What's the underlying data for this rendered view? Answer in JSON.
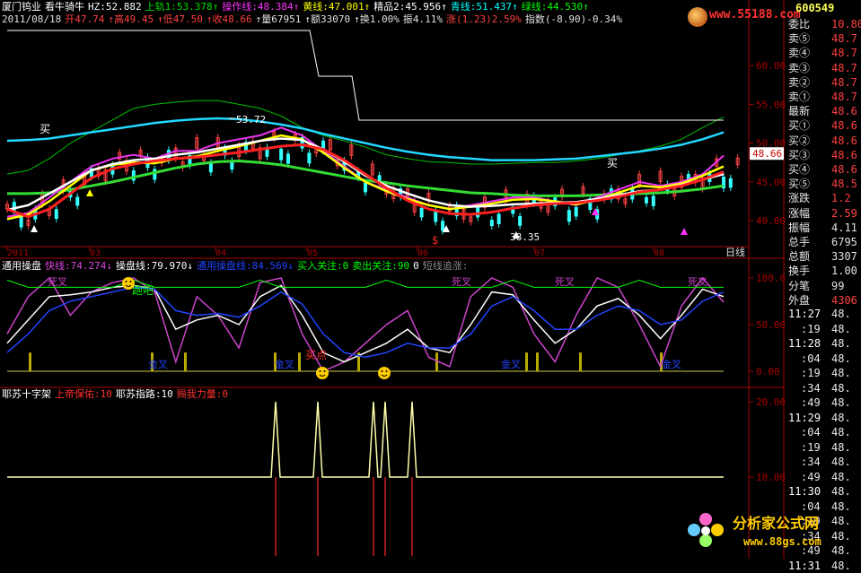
{
  "stock": {
    "name": "厦门钨业",
    "date": "2011/08/18"
  },
  "header": {
    "line1": [
      {
        "text": "厦门钨业",
        "color": "#ffffff"
      },
      {
        "text": "看牛骑牛",
        "color": "#ffffff"
      },
      {
        "text": "HZ:52.882",
        "color": "#ffffff"
      },
      {
        "text": "上轨1:53.378↑",
        "color": "#00e000"
      },
      {
        "text": "操作线:48.384↑",
        "color": "#ff33ff"
      },
      {
        "text": "黄线:47.001↑",
        "color": "#ffff00"
      },
      {
        "text": "精品2:45.956↑",
        "color": "#ffffff"
      },
      {
        "text": "青线:51.437↑",
        "color": "#00ffff"
      },
      {
        "text": "绿线:44.530↑",
        "color": "#00ff00"
      }
    ],
    "line2": [
      {
        "text": "2011/08/18",
        "color": "#e0e0e0"
      },
      {
        "text": "开47.74",
        "color": "#ff4040"
      },
      {
        "text": "↑高49.45",
        "color": "#ff4040"
      },
      {
        "text": "↑低47.50",
        "color": "#ff4040"
      },
      {
        "text": "↑收48.66",
        "color": "#ff4040"
      },
      {
        "text": "↑量67951",
        "color": "#e0e0e0"
      },
      {
        "text": "↑额33070",
        "color": "#e0e0e0"
      },
      {
        "text": "↑换1.00%",
        "color": "#e0e0e0"
      },
      {
        "text": "振4.11%",
        "color": "#e0e0e0"
      },
      {
        "text": "涨(1.23)2.59%",
        "color": "#ff4040"
      },
      {
        "text": "指数(-8.90)-0.34%",
        "color": "#e0e0e0"
      }
    ]
  },
  "main_chart": {
    "y_ticks": [
      "60.00",
      "55.00",
      "50.00",
      "45.00",
      "40.00"
    ],
    "x_labels": [
      "2011",
      "03",
      "04",
      "05",
      "06",
      "07",
      "08"
    ],
    "x_axis_unit": "日线",
    "annotations": {
      "high": "53.72",
      "low": "38.35",
      "buy1": "买",
      "buy2": "买",
      "sell": "$"
    },
    "current_price": "48.66",
    "watermark": "www.55188.com"
  },
  "indicator1": {
    "legend": [
      {
        "text": "通用操盘",
        "color": "#ffffff"
      },
      {
        "text": "快线:74.274↓",
        "color": "#dd44dd"
      },
      {
        "text": "操盘线:79.970↓",
        "color": "#ffffff"
      },
      {
        "text": "通用操盘线:84.569↓",
        "color": "#2244ff"
      },
      {
        "text": "买入关注:0",
        "color": "#00ff00"
      },
      {
        "text": "卖出关注:90",
        "color": "#00ff00"
      },
      {
        "text": "0",
        "color": "#ffffff"
      },
      {
        "text": "短线追涨:",
        "color": "#888888"
      }
    ],
    "y_ticks": [
      "100.00",
      "50.00",
      "0.00"
    ],
    "labels": {
      "dead_cross_1": "死叉",
      "dead_cross_2": "死叉",
      "dead_cross_3": "死叉",
      "dead_cross_4": "死叉",
      "run": "跑吧",
      "buy_point": "买点",
      "gold_1": "金叉",
      "gold_2": "金叉",
      "gold_3": "金叉",
      "gold_4": "金叉"
    }
  },
  "indicator2": {
    "legend": [
      {
        "text": "耶苏十字架",
        "color": "#ffffff"
      },
      {
        "text": "上帝保佑:10",
        "color": "#ff3030"
      },
      {
        "text": "耶苏指路:10",
        "color": "#ffffff"
      },
      {
        "text": "赐我力量:0",
        "color": "#ff3030"
      }
    ],
    "y_ticks": [
      "20.00",
      "10.00"
    ]
  },
  "quote_panel": {
    "code": "600549",
    "rows": [
      {
        "label": "委比",
        "value": "10.80",
        "color": "#ff4040"
      },
      {
        "label": "卖⑤",
        "value": "48.7",
        "color": "#ff4040"
      },
      {
        "label": "卖④",
        "value": "48.7",
        "color": "#ff4040"
      },
      {
        "label": "卖③",
        "value": "48.7",
        "color": "#ff4040"
      },
      {
        "label": "卖②",
        "value": "48.7",
        "color": "#ff4040"
      },
      {
        "label": "卖①",
        "value": "48.7",
        "color": "#ff4040"
      },
      {
        "label": "最新",
        "value": "48.6",
        "color": "#ff4040"
      },
      {
        "label": "买①",
        "value": "48.6",
        "color": "#ff4040"
      },
      {
        "label": "买②",
        "value": "48.6",
        "color": "#ff4040"
      },
      {
        "label": "买③",
        "value": "48.6",
        "color": "#ff4040"
      },
      {
        "label": "买④",
        "value": "48.6",
        "color": "#ff4040"
      },
      {
        "label": "买⑤",
        "value": "48.5",
        "color": "#ff4040"
      },
      {
        "label": "涨跌",
        "value": "1.2",
        "color": "#ff4040"
      },
      {
        "label": "涨幅",
        "value": "2.59",
        "color": "#ff4040"
      },
      {
        "label": "振幅",
        "value": "4.11",
        "color": "#e0e0e0"
      },
      {
        "label": "总手",
        "value": "6795",
        "color": "#e0e0e0"
      },
      {
        "label": "总额",
        "value": "3307",
        "color": "#e0e0e0"
      },
      {
        "label": "换手",
        "value": "1.00",
        "color": "#e0e0e0"
      },
      {
        "label": "分笔",
        "value": "99",
        "color": "#e0e0e0"
      },
      {
        "label": "外盘",
        "value": "4306",
        "color": "#ff4040"
      }
    ],
    "ticks": [
      {
        "time": "11:27",
        "price": "48."
      },
      {
        "time": ":19",
        "price": "48."
      },
      {
        "time": "11:28",
        "price": "48."
      },
      {
        "time": ":04",
        "price": "48."
      },
      {
        "time": ":19",
        "price": "48."
      },
      {
        "time": ":34",
        "price": "48."
      },
      {
        "time": ":49",
        "price": "48."
      },
      {
        "time": "11:29",
        "price": "48."
      },
      {
        "time": ":04",
        "price": "48."
      },
      {
        "time": ":19",
        "price": "48."
      },
      {
        "time": ":34",
        "price": "48."
      },
      {
        "time": ":49",
        "price": "48."
      },
      {
        "time": "11:30",
        "price": "48."
      },
      {
        "time": ":04",
        "price": "48."
      },
      {
        "time": ":19",
        "price": "48."
      },
      {
        "time": ":34",
        "price": "48."
      },
      {
        "time": ":49",
        "price": "48."
      },
      {
        "time": "11:31",
        "price": "48."
      }
    ]
  },
  "footer_logo": {
    "name": "分析家公式网",
    "url": "www.88gs.com"
  },
  "chart_data": [
    {
      "type": "line",
      "title": "",
      "ylim": [
        37,
        65
      ],
      "x_ticks": [
        "2011",
        "03",
        "04",
        "05",
        "06",
        "07",
        "08"
      ],
      "series": [
        {
          "name": "上轨1",
          "color": "#00c000",
          "values": [
            46,
            46.5,
            48,
            50,
            51.5,
            53,
            54.5,
            55,
            55.3,
            55.5,
            55.5,
            55,
            54.5,
            53.5,
            52,
            51,
            50.3,
            49.5,
            48.5,
            48,
            47.6,
            47.5,
            47.3,
            47.3,
            47.4,
            47.5,
            47.5,
            47.7,
            48,
            48.5,
            49,
            49.6,
            50.5,
            52,
            53.4
          ]
        },
        {
          "name": "青线",
          "color": "#22d8ff",
          "values": [
            50.3,
            50.4,
            50.6,
            51,
            51.4,
            51.8,
            52.2,
            52.6,
            52.9,
            53.1,
            53.2,
            53.1,
            52.8,
            52.4,
            51.9,
            51.2,
            50.6,
            50,
            49.4,
            48.9,
            48.5,
            48.2,
            48,
            47.8,
            47.8,
            47.8,
            47.9,
            48,
            48.3,
            48.6,
            48.9,
            49.3,
            49.8,
            50.5,
            51.4
          ]
        },
        {
          "name": "绿线",
          "color": "#33dd33",
          "values": [
            43.5,
            43.5,
            43.6,
            44,
            44.5,
            45,
            45.6,
            46.2,
            46.8,
            47.3,
            47.6,
            47.7,
            47.5,
            47.2,
            46.7,
            46.2,
            45.7,
            45.2,
            44.9,
            44.5,
            44.2,
            43.9,
            43.6,
            43.5,
            43.3,
            43.2,
            43.2,
            43.2,
            43.3,
            43.4,
            43.5,
            43.6,
            43.8,
            44.1,
            44.5
          ]
        },
        {
          "name": "操作线",
          "color": "#ee33ee",
          "values": [
            40.5,
            41,
            43,
            45,
            47,
            48,
            48.5,
            48,
            49,
            49,
            50,
            50.5,
            51,
            52,
            51,
            49,
            47,
            45,
            44,
            43,
            42,
            41.5,
            42,
            42.5,
            43,
            43,
            42.5,
            42,
            43,
            44,
            45,
            44.5,
            45,
            46,
            48.4
          ]
        },
        {
          "name": "黄线",
          "color": "#ffff00",
          "values": [
            40.2,
            40.8,
            42.5,
            44.5,
            46.5,
            47.2,
            47.5,
            47.4,
            48,
            48.3,
            49,
            49.6,
            50.3,
            51,
            50.5,
            48.8,
            46.8,
            45,
            43.8,
            42.8,
            42,
            41.5,
            41.8,
            42.2,
            42.7,
            42.8,
            42.5,
            42.1,
            42.7,
            43.6,
            44.5,
            44.3,
            44.8,
            45.8,
            47
          ]
        },
        {
          "name": "精品2",
          "color": "#ffffff",
          "values": [
            41.4,
            42,
            43.5,
            45,
            46.5,
            47.3,
            47.8,
            48,
            48.5,
            48.8,
            49.3,
            49.8,
            50.3,
            50.6,
            50.4,
            49.2,
            47.6,
            45.8,
            44.5,
            43.5,
            42.6,
            42,
            41.8,
            41.9,
            42.1,
            42.2,
            42.3,
            42.4,
            42.8,
            43.3,
            43.8,
            44,
            44.6,
            45.3,
            46
          ]
        },
        {
          "name": "HZ",
          "color": "#ff2020",
          "values": [
            41.5,
            40.5,
            41.5,
            43.5,
            45.5,
            46.7,
            47.3,
            47.7,
            48,
            48.2,
            48.5,
            48.8,
            49.2,
            49.6,
            49.8,
            49.2,
            47.8,
            46,
            44.2,
            42.6,
            41.5,
            40.9,
            40.8,
            41.1,
            41.6,
            42,
            42.2,
            42.3,
            42.6,
            43.1,
            43.7,
            44,
            44.5,
            45.3,
            46.3
          ]
        }
      ]
    },
    {
      "type": "line",
      "title": "",
      "ylim": [
        0,
        100
      ],
      "x_ticks": [
        "2011",
        "03",
        "04",
        "05",
        "06",
        "07",
        "08"
      ],
      "series": [
        {
          "name": "快线",
          "color": "#cc44cc",
          "values": [
            40,
            80,
            100,
            60,
            85,
            95,
            100,
            85,
            10,
            80,
            60,
            25,
            95,
            100,
            40,
            0,
            10,
            30,
            50,
            65,
            15,
            5,
            80,
            100,
            90,
            40,
            10,
            60,
            100,
            90,
            50,
            5,
            70,
            100,
            74
          ]
        },
        {
          "name": "操盘线",
          "color": "#ffffff",
          "values": [
            30,
            55,
            80,
            82,
            85,
            90,
            92,
            88,
            45,
            55,
            60,
            50,
            80,
            92,
            60,
            20,
            10,
            20,
            30,
            45,
            25,
            20,
            50,
            85,
            82,
            55,
            30,
            45,
            70,
            78,
            60,
            35,
            60,
            88,
            80
          ]
        },
        {
          "name": "通用操盘线",
          "color": "#2244ff",
          "values": [
            20,
            40,
            65,
            75,
            80,
            85,
            90,
            88,
            65,
            60,
            62,
            58,
            70,
            85,
            72,
            40,
            20,
            15,
            20,
            30,
            25,
            25,
            40,
            70,
            80,
            65,
            45,
            45,
            60,
            70,
            65,
            50,
            55,
            75,
            85
          ]
        },
        {
          "name": "卖出关注",
          "color": "#00ff00",
          "values": [
            90,
            90,
            90,
            90,
            90,
            90,
            90,
            90,
            90,
            90,
            90,
            90,
            90,
            90,
            90,
            90,
            90,
            90,
            90,
            90,
            90,
            90,
            90,
            90,
            90,
            90,
            90,
            90,
            90,
            90,
            90,
            90,
            90,
            90,
            90
          ]
        }
      ]
    },
    {
      "type": "line",
      "title": "",
      "ylim": [
        0,
        22
      ],
      "series": [
        {
          "name": "上帝保佑",
          "color": "#ffffaa",
          "values": [
            10,
            10,
            10,
            10,
            10,
            10,
            10,
            10,
            10,
            10,
            10,
            10,
            10,
            10,
            20,
            10,
            20,
            10,
            10,
            20,
            20,
            10,
            20,
            10,
            10,
            10,
            10,
            10,
            10,
            10,
            10,
            10,
            10,
            10,
            10
          ]
        }
      ]
    }
  ]
}
